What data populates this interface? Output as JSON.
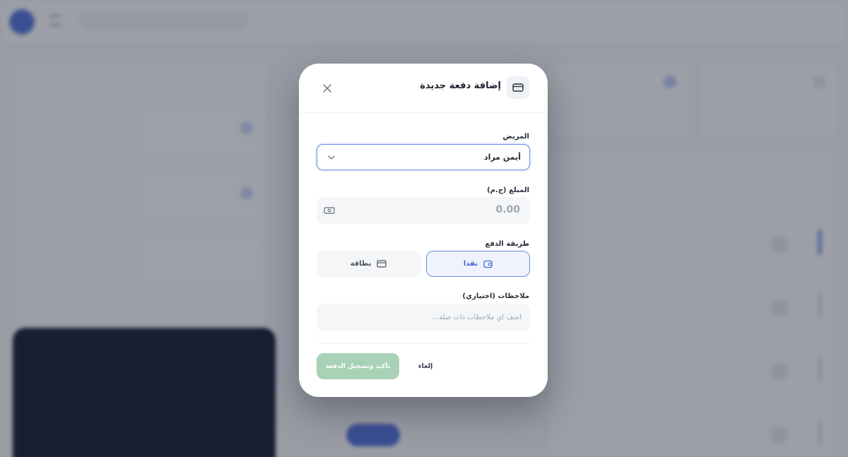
{
  "modal": {
    "title": "إضافة دفعة جديدة",
    "patient": {
      "label": "المريض",
      "value": "أيمن مراد"
    },
    "amount": {
      "label": "المبلغ (ج.م)",
      "value": "0.00"
    },
    "payment_method": {
      "label": "طريقة الدفع",
      "options": [
        {
          "label": "نقدا",
          "selected": true
        },
        {
          "label": "بطاقة",
          "selected": false
        }
      ]
    },
    "notes": {
      "label": "ملاحظات (اختياري)",
      "placeholder": "أضف أي ملاحظات ذات صلة..."
    },
    "confirm_label": "تأكيد وتسجيل الدفعة",
    "cancel_label": "إلغاء"
  },
  "colors": {
    "accent": "#6f8de3",
    "confirm_button": "#a9d1b6",
    "overlay": "#1e2434"
  }
}
